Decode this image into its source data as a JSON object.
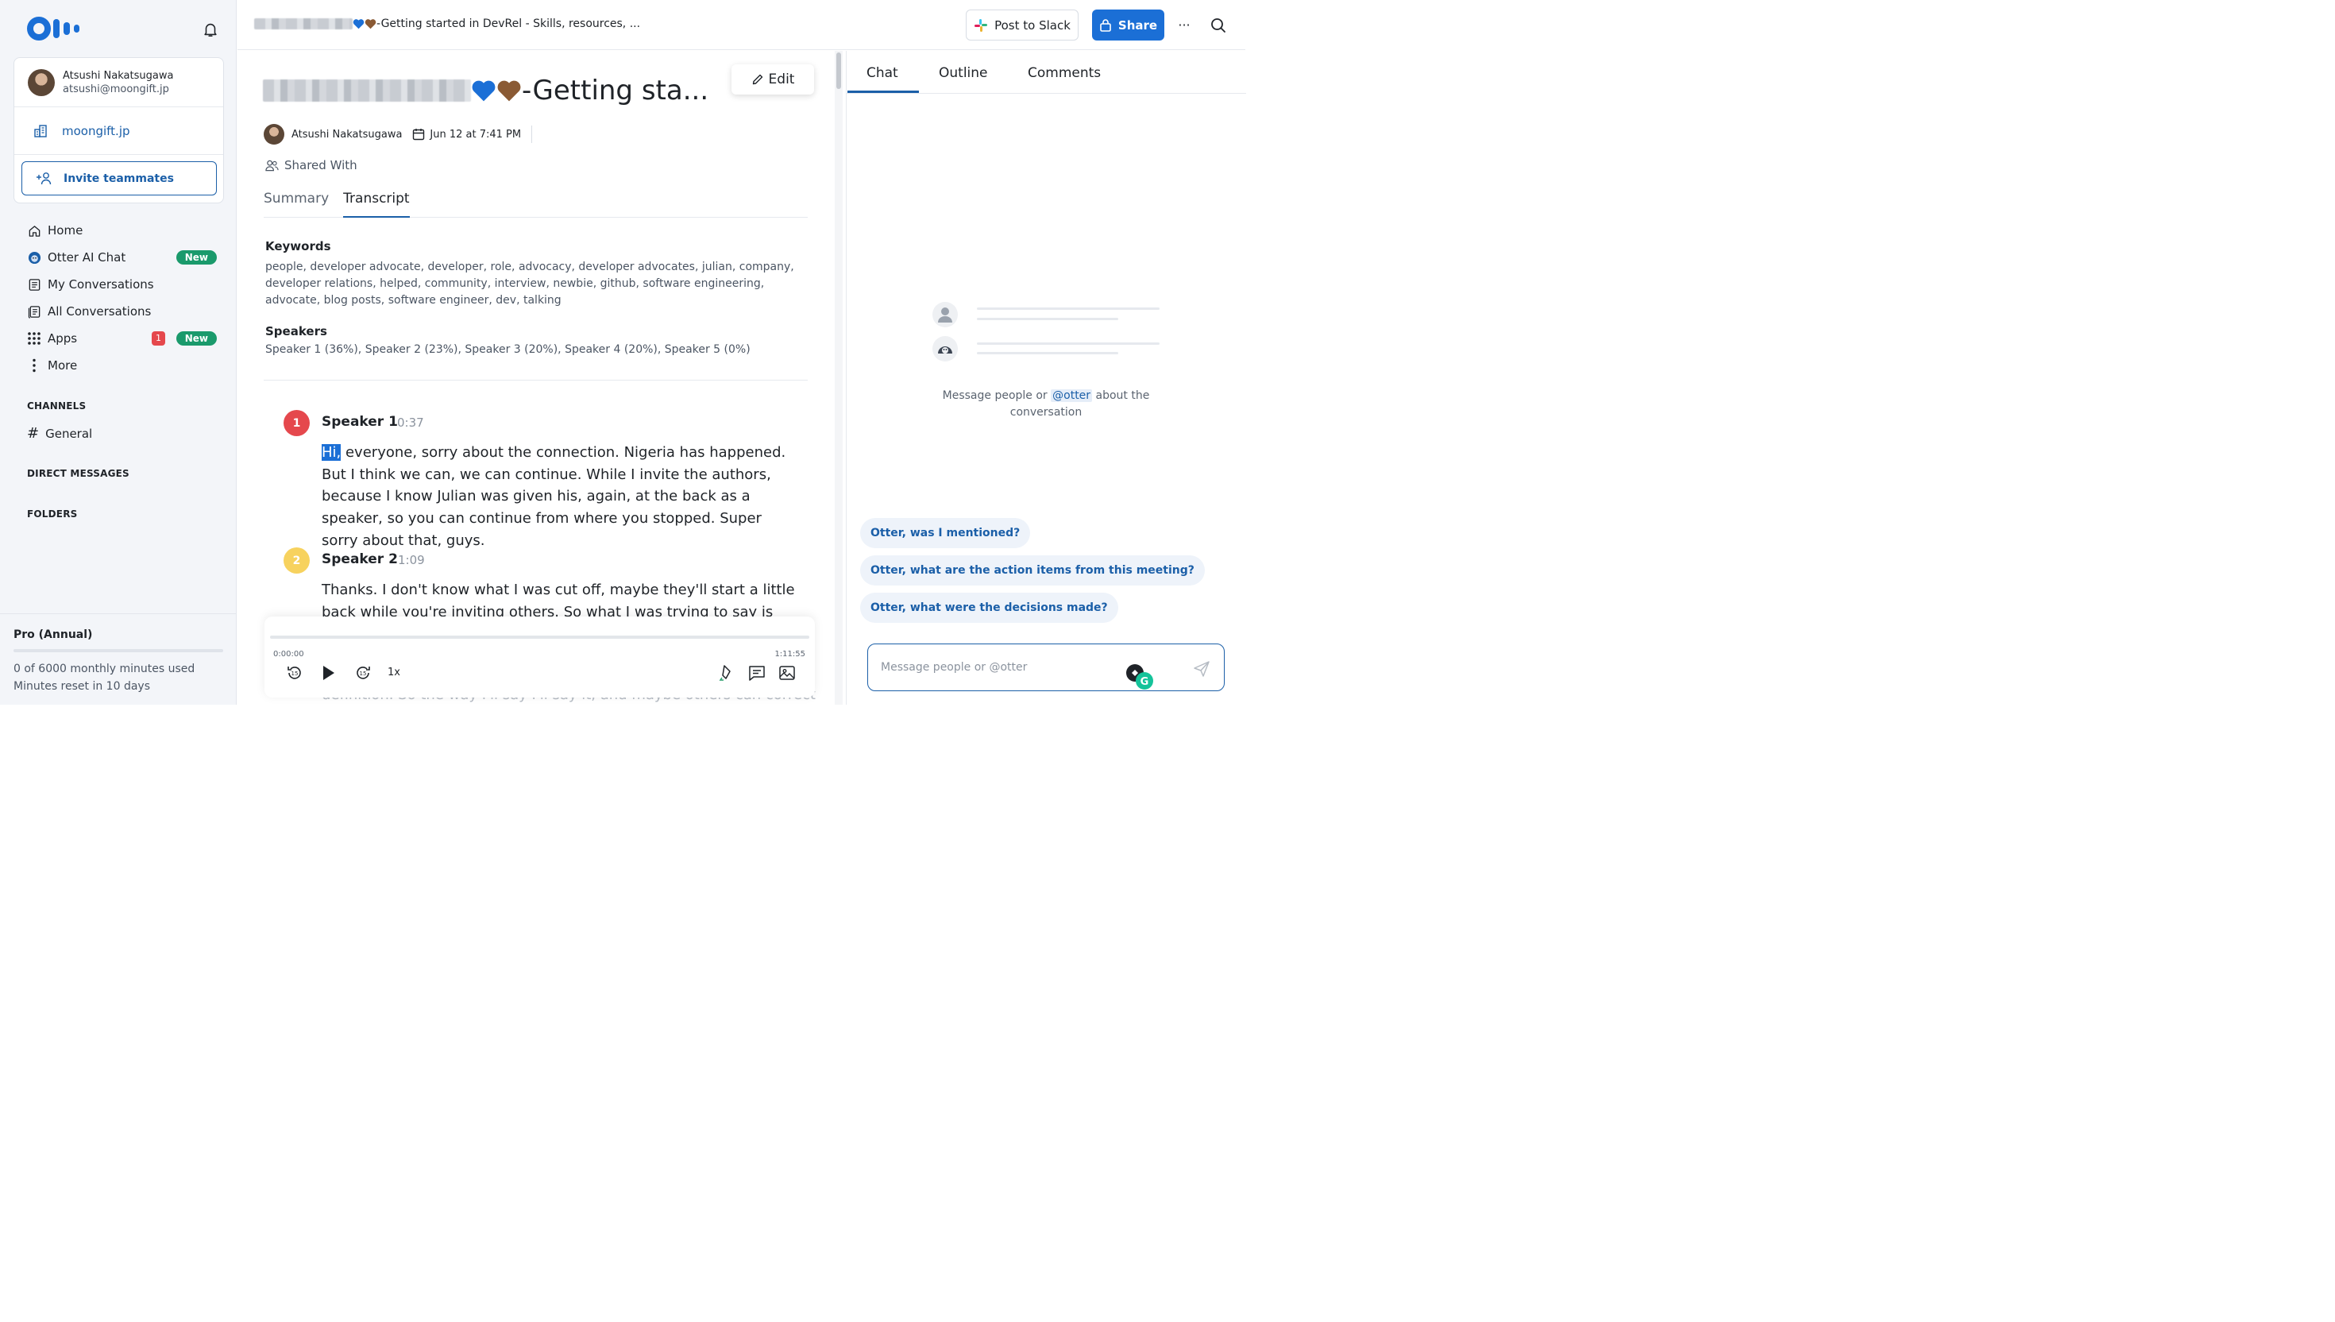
{
  "sidebar": {
    "account": {
      "name": "Atsushi Nakatsugawa",
      "email": "atsushi@moongift.jp"
    },
    "workspace": "moongift.jp",
    "invite_label": "Invite teammates",
    "nav": [
      {
        "label": "Home",
        "icon": "home-icon"
      },
      {
        "label": "Otter AI Chat",
        "icon": "otter-chat-icon",
        "badge": "New"
      },
      {
        "label": "My Conversations",
        "icon": "conversation-icon"
      },
      {
        "label": "All Conversations",
        "icon": "all-conversations-icon"
      },
      {
        "label": "Apps",
        "icon": "apps-grid-icon",
        "count": "1",
        "badge": "New"
      },
      {
        "label": "More",
        "icon": "more-vertical-icon"
      }
    ],
    "sections": {
      "channels": "CHANNELS",
      "direct_messages": "DIRECT MESSAGES",
      "folders": "FOLDERS"
    },
    "channels": [
      {
        "label": "General"
      }
    ],
    "plan": {
      "title": "Pro (Annual)",
      "minutes_used": "0 of 6000 monthly minutes used",
      "reset": "Minutes reset in 10 days",
      "usage_fraction": 0
    }
  },
  "topbar": {
    "doc_path_suffix": "-Getting started in DevRel - Skills, resources, ...",
    "post_slack_label": "Post to Slack",
    "share_label": "Share",
    "more_label": "···"
  },
  "main": {
    "title_suffix": "-Getting sta...",
    "edit_label": "Edit",
    "author": "Atsushi Nakatsugawa",
    "date": "Jun 12 at 7:41 PM",
    "shared_with": "Shared With",
    "tabs": [
      {
        "label": "Summary"
      },
      {
        "label": "Transcript",
        "active": true
      }
    ],
    "keywords_title": "Keywords",
    "keywords": "people, developer advocate, developer, role, advocacy, developer advocates, julian, company, developer relations, helped, community, interview, newbie, github, software engineering, advocate, blog posts, software engineer, dev, talking",
    "speakers_title": "Speakers",
    "speakers": "Speaker 1 (36%), Speaker 2 (23%), Speaker 3 (20%), Speaker 4 (20%), Speaker 5 (0%)",
    "segments": [
      {
        "num": "1",
        "speaker": "Speaker 1",
        "time": "0:37",
        "color": "#e5484d",
        "highlight": "Hi,",
        "text": " everyone, sorry about the connection. Nigeria has happened. But I think we can, we can continue. While I invite the authors, because I know Julian was given his, again, at the back as a speaker, so you can continue from where you stopped. Super sorry about that, guys."
      },
      {
        "num": "2",
        "speaker": "Speaker 2",
        "time": "1:09",
        "color": "#f7d25e",
        "text": "Thanks. I don't know what I was cut off, maybe they'll start a little back while you're inviting others. So what I was trying to say is first,"
      }
    ],
    "faded_text": "definition. So the way I'll say I'll say it, and maybe others can correct",
    "player": {
      "current": "0:00:00",
      "duration": "1:11:55",
      "speed": "1x",
      "progress_fraction": 0
    }
  },
  "chat_panel": {
    "tabs": [
      {
        "label": "Chat",
        "active": true
      },
      {
        "label": "Outline"
      },
      {
        "label": "Comments"
      }
    ],
    "empty_pre": "Message people or ",
    "empty_mention": "@otter",
    "empty_post": " about the conversation",
    "suggestions": [
      "Otter, was I mentioned?",
      "Otter, what are the action items from this meeting?",
      "Otter, what were the decisions made?"
    ],
    "input_placeholder": "Message people or @otter"
  },
  "colors": {
    "accent": "#1b5fa8",
    "share": "#1b6fd6",
    "new_badge": "#1a9a6c",
    "alert": "#e5484d"
  }
}
